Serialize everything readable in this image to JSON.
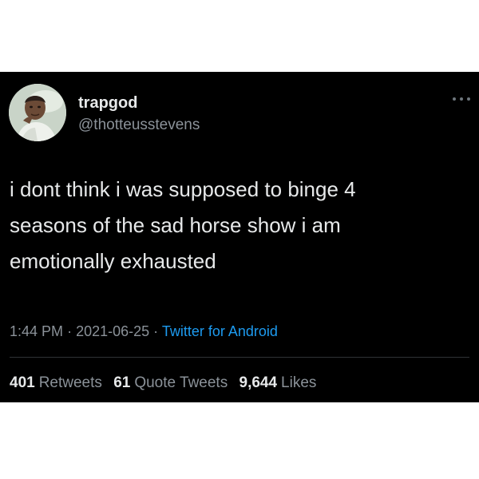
{
  "tweet": {
    "display_name": "trapgod",
    "handle": "@thotteusstevens",
    "text_lines": [
      "i dont think i was supposed to binge 4",
      "seasons of the sad horse show i am",
      "emotionally exhausted"
    ],
    "time": "1:44 PM",
    "date": "2021-06-25",
    "separator": "·",
    "source": "Twitter for Android",
    "stats": {
      "retweets": {
        "count": "401",
        "label": "Retweets"
      },
      "quote_tweets": {
        "count": "61",
        "label": "Quote Tweets"
      },
      "likes": {
        "count": "9,644",
        "label": "Likes"
      }
    }
  },
  "icons": {
    "more": "more-horizontal-icon",
    "avatar": "profile-avatar"
  },
  "colors": {
    "background": "#000000",
    "text": "#e7e9ea",
    "secondary_text": "#8b9299",
    "link": "#1d9bf0",
    "page": "#ffffff"
  }
}
